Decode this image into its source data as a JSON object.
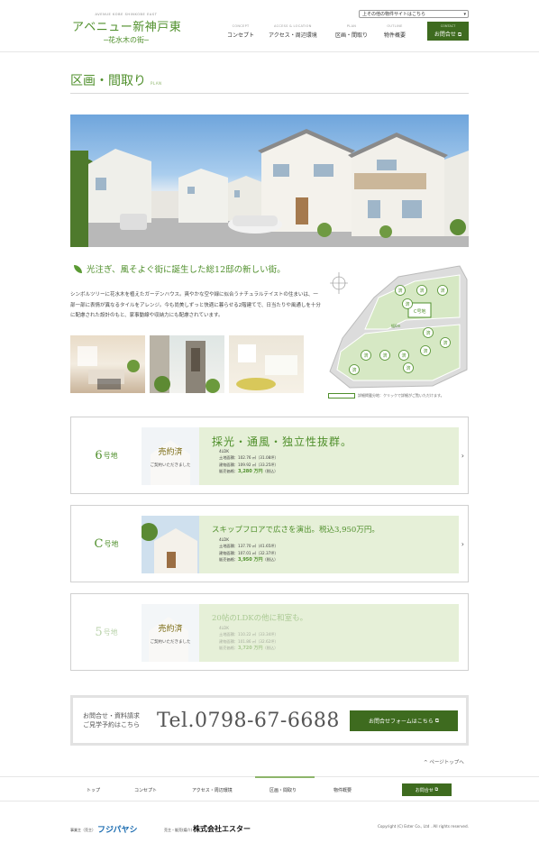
{
  "header": {
    "logo_en": "AVENUE KOBE SHINKOBE EAST",
    "logo_ja": "アベニュー新神戸東",
    "logo_sub": "─花水木の街─",
    "site_select": "上その他の物件サイトはこちら",
    "nav": [
      {
        "en": "CONCEPT",
        "ja": "コンセプト"
      },
      {
        "en": "ACCESS & LOCATION",
        "ja": "アクセス・周辺環境"
      },
      {
        "en": "PLAN",
        "ja": "区画・間取り"
      },
      {
        "en": "OUTLINE",
        "ja": "物件概要"
      }
    ],
    "contact": {
      "en": "CONTACT",
      "ja": "お問合せ"
    }
  },
  "section": {
    "title_ja": "区画・間取り",
    "title_en": "PLAN"
  },
  "catch": "光注ぎ、風そよぐ街に誕生した総12邸の新しい街。",
  "description": "シンボルツリーに花水木を植えたガーデンハウス。爽やかな空や緑に似合うナチュラルテイストの住まいは、一部一部に表情が異なるタイルをアレンジ。今も尚美しずっと快適に暮らせる2階建てで、日当たりや風通しを十分に配慮された設計のもと、家事動線や収納力にも配慮されています。",
  "map": {
    "sold_mark": "済",
    "lot_c": "C号地",
    "road_width": "幅6m",
    "note": "詳細掲載分地：クリックで詳細がご覧いただけます。"
  },
  "cards": [
    {
      "lot": "6",
      "lot_suffix": "号地",
      "headline": "採光・通風・独立性抜群。",
      "sold_big": "売約済",
      "sold_small": "ご契約いただきました",
      "type": "4LDK",
      "land": "土地面積：102.76 ㎡（31.08坪）",
      "building": "建物面積：109.92 ㎡（33.25坪）",
      "price_label": "販売価格：",
      "price": "3,280 万円",
      "price_note": "（税込）"
    },
    {
      "lot": "C",
      "lot_suffix": "号地",
      "headline": "スキップフロアで広さを演出。税込3,950万円。",
      "sold_big": "",
      "sold_small": "",
      "type": "4LDK",
      "land": "土地面積：137.70 ㎡（41.65坪）",
      "building": "建物面積：107.01 ㎡（32.37坪）",
      "price_label": "販売価格：",
      "price": "3,950 万円",
      "price_note": "（税込）"
    },
    {
      "lot": "5",
      "lot_suffix": "号地",
      "headline": "20帖のLDKの他に和室も。",
      "sold_big": "売約済",
      "sold_small": "ご契約いただきました",
      "type": "4LDK",
      "land": "土地面積：110.22 ㎡（33.34坪）",
      "building": "建物面積：101.86 ㎡（32.62坪）",
      "price_label": "販売価格：",
      "price": "3,720 万円",
      "price_note": "（税込）"
    }
  ],
  "contact_band": {
    "line1": "お問合せ・資料請求",
    "line2": "ご見学予約はこちら",
    "tel": "Tel.0798-67-6688",
    "button": "お問合せフォームはこちら"
  },
  "page_top": "ページトップへ",
  "footer_nav": [
    "トップ",
    "コンセプト",
    "アクセス・周辺環境",
    "区画・間取り",
    "物件概要"
  ],
  "footer_contact": "お問合せ",
  "footer": {
    "seller_label": "事業主（売主）",
    "seller": "フジパヤシ",
    "agent_label": "売主・販売(媒介)",
    "agent": "株式会社エスター",
    "copyright": "Copyright (C) Ester Co., Ltd . All rights reserved."
  },
  "colors": {
    "accent": "#4f8f2b",
    "button": "#3e6b1f",
    "card_bg": "#e6f0d8"
  }
}
